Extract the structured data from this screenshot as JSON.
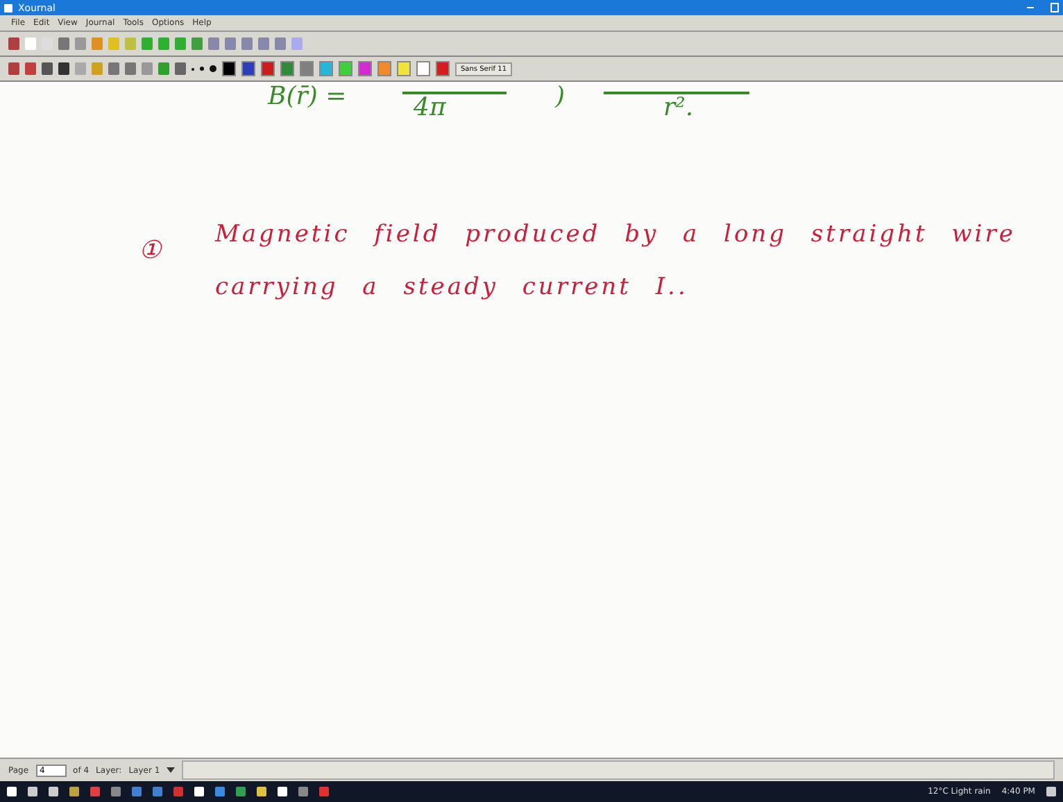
{
  "window": {
    "title": "Xournal"
  },
  "menu": [
    "File",
    "Edit",
    "View",
    "Journal",
    "Tools",
    "Options",
    "Help"
  ],
  "palette": [
    {
      "color": "#000000"
    },
    {
      "color": "#2a3fb8"
    },
    {
      "color": "#c81e1e"
    },
    {
      "color": "#2e8b3a"
    },
    {
      "color": "#808080"
    },
    {
      "color": "#27b6d8"
    },
    {
      "color": "#3ad13a"
    },
    {
      "color": "#d42ad4"
    },
    {
      "color": "#f08a2a"
    },
    {
      "color": "#f0e43a"
    },
    {
      "color": "#ffffff"
    },
    {
      "color": "#d41e1e"
    }
  ],
  "font_button": "Sans Serif 11",
  "notes": [
    {
      "kind": "equation",
      "text": "B(r̄) =",
      "color": "#3a8a2a"
    },
    {
      "kind": "equation",
      "text": "4π",
      "color": "#3a8a2a"
    },
    {
      "kind": "equation",
      "text": ")",
      "color": "#3a8a2a"
    },
    {
      "kind": "equation",
      "text": "r².",
      "color": "#3a8a2a"
    },
    {
      "kind": "marker",
      "text": "①",
      "color": "#c8203a"
    },
    {
      "kind": "line",
      "text": "Magnetic field produced by a long straight wire",
      "color": "#c8203a"
    },
    {
      "kind": "line",
      "text": "carrying a steady current I..",
      "color": "#c8203a"
    }
  ],
  "status_bar": {
    "page_label": "Page",
    "page": "4",
    "of": "of 4",
    "layer_label": "Layer:",
    "layer": "Layer 1"
  },
  "tray": {
    "weather": "12°C Light rain",
    "time": "4:40 PM"
  }
}
